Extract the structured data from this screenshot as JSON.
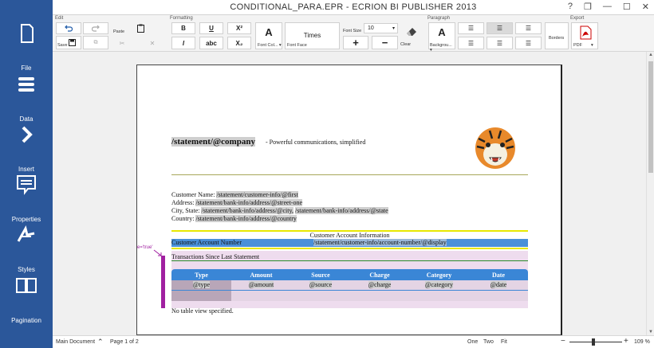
{
  "window": {
    "title": "CONDITIONAL_PARA.EPR - ECRION BI PUBLISHER 2013",
    "help": "?",
    "restore": "❐",
    "minimize": "—",
    "maximize": "☐",
    "close": "✕"
  },
  "sidebar": {
    "items": [
      {
        "label": "File",
        "icon": "file-icon"
      },
      {
        "label": "Data",
        "icon": "data-icon"
      },
      {
        "label": "Insert",
        "icon": "insert-icon"
      },
      {
        "label": "Properties",
        "icon": "properties-icon"
      },
      {
        "label": "Styles",
        "icon": "styles-icon"
      },
      {
        "label": "Pagination",
        "icon": "pagination-icon"
      }
    ]
  },
  "ribbon": {
    "groups": {
      "edit": "Edit",
      "formatting": "Formatting",
      "paragraph": "Paragraph",
      "export": "Export"
    },
    "save": "Save",
    "paste": "Paste",
    "bold": "B",
    "underline": "U",
    "superscript": "X²",
    "italic": "I",
    "strike": "abc",
    "subscript": "X₂",
    "font_color_label": "Font Col... ▾",
    "font_color_glyph": "A",
    "font_face_value": "Times",
    "font_face_label": "Font Face",
    "font_size_label": "Font Size",
    "font_size_value": "10",
    "plus": "+",
    "minus": "−",
    "clear": "Clear",
    "background_label": "Backgrou... ▾",
    "background_glyph": "A",
    "borders": "Borders",
    "pdf_label": "PDF",
    "pdf_caret": "▾"
  },
  "document": {
    "company_field": "/statement/@company",
    "tagline": " -  Powerful communications, simplified",
    "customer_name_label": "Customer Name:",
    "customer_name_field": "/statement/customer-info/@first",
    "address_label": "Address:",
    "address_field": "/statement/bank-info/address/@street-one",
    "city_state_label": "City, State:",
    "city_field": "/statement/bank-info/address/@city,",
    "state_field": "/statement/bank-info/address/@state",
    "country_label": "Country:",
    "country_field": "/statement/bank-info/address/@country",
    "account_info_heading": "Customer Account Information",
    "account_number_label": "Customer Account Number",
    "account_number_field": "/statement/customer-info/account-number/@display",
    "condition_marker": "e='true'",
    "transactions_heading": "Transactions Since Last Statement",
    "table_headers": [
      "Type",
      "Amount",
      "Source",
      "Charge",
      "Category",
      "Date"
    ],
    "table_row": [
      "@type",
      "@amount",
      "@source",
      "@charge",
      "@category",
      "@date"
    ],
    "no_table_view": "No table view specified."
  },
  "statusbar": {
    "main_document": "Main Document",
    "page": "Page 1 of 2",
    "view_one": "One",
    "view_two": "Two",
    "view_fit": "Fit",
    "zoom": "109 %"
  },
  "colors": {
    "sidebar": "#2b579a",
    "table_header": "#3a86d6",
    "account_bar": "#4a90d9",
    "yellow_rule": "#e8e800",
    "condition_bar": "#a020a0"
  }
}
